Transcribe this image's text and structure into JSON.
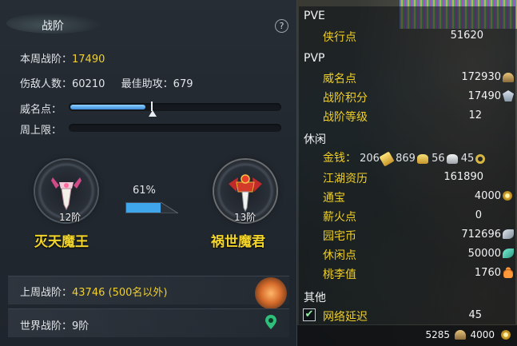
{
  "left": {
    "title": "战阶",
    "help": "?",
    "week_rank_label": "本周战阶：",
    "week_rank_value": "17490",
    "enemies_label": "伤敌人数：",
    "enemies_value": "60210",
    "best_assist_label": "最佳助攻：",
    "best_assist_value": "679",
    "prestige_label": "威名点：",
    "prestige_progress": 0.36,
    "weekly_cap_label": "周上限：",
    "weekly_cap_progress": 0.0,
    "current_badge": {
      "name": "灭天魔王",
      "level": "12阶"
    },
    "next_badge": {
      "name": "祸世魔君",
      "level": "13阶"
    },
    "progress_percent": "61%",
    "progress_value": 0.61,
    "last_week_label": "上周战阶：",
    "last_week_value": "43746 (500名以外)",
    "world_rank_label": "世界战阶：",
    "world_rank_value": "9阶"
  },
  "right": {
    "pve": {
      "header": "PVE",
      "items": [
        {
          "label": "侠行点",
          "value": "51620"
        }
      ]
    },
    "pvp": {
      "header": "PVP",
      "items": [
        {
          "label": "威名点",
          "value": "172930",
          "icon": "fan-icon"
        },
        {
          "label": "战阶积分",
          "value": "17490",
          "icon": "crest-icon"
        },
        {
          "label": "战阶等级",
          "value": "12"
        }
      ]
    },
    "leisure": {
      "header": "休闲",
      "money": {
        "label": "金钱：",
        "gold": "206",
        "silver": "869",
        "copper": "56",
        "coin": "45"
      },
      "items": [
        {
          "label": "江湖资历",
          "value": "161890"
        },
        {
          "label": "通宝",
          "value": "4000",
          "icon": "coin-icon"
        },
        {
          "label": "薪火点",
          "value": "0"
        },
        {
          "label": "园宅币",
          "value": "712696",
          "icon": "feather-icon"
        },
        {
          "label": "休闲点",
          "value": "50000",
          "icon": "leaf-icon"
        },
        {
          "label": "桃李值",
          "value": "1760",
          "icon": "gourd-icon"
        }
      ]
    },
    "other": {
      "header": "其他",
      "items": [
        {
          "label": "网络延迟",
          "value": "45",
          "checked": true
        }
      ]
    },
    "footer": {
      "left_value": "5285",
      "right_value": "4000"
    }
  }
}
